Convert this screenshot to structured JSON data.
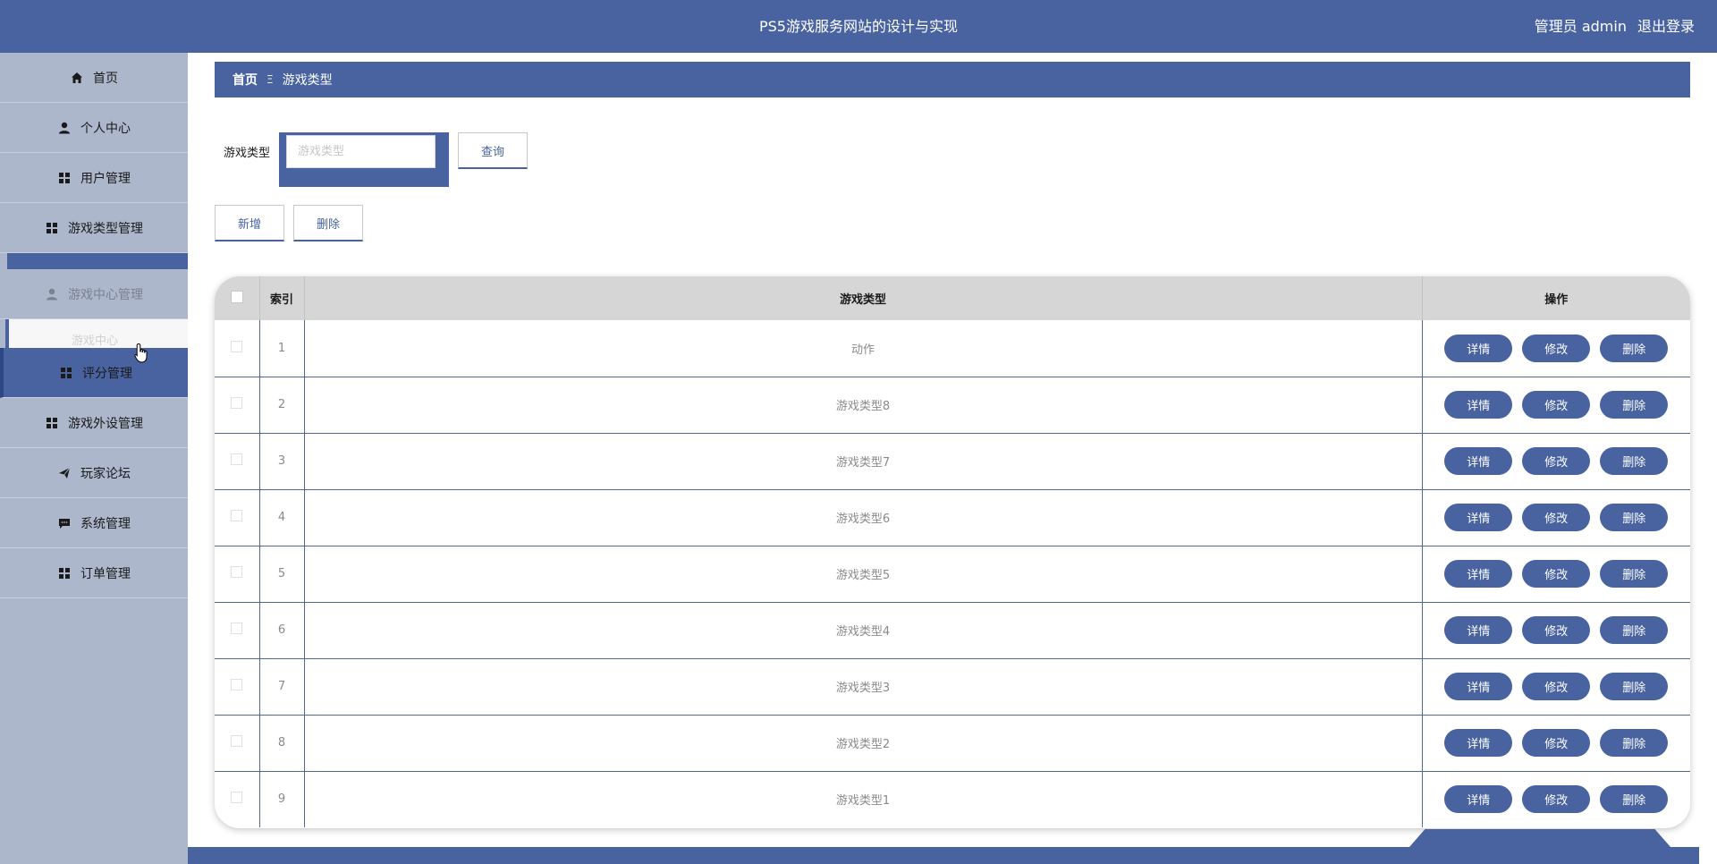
{
  "header": {
    "title": "PS5游戏服务网站的设计与实现",
    "user_label": "管理员 admin",
    "logout_label": "退出登录"
  },
  "sidebar": {
    "items": [
      {
        "label": "首页",
        "icon": "home-icon"
      },
      {
        "label": "个人中心",
        "icon": "person-icon"
      },
      {
        "label": "用户管理",
        "icon": "grid-icon"
      },
      {
        "label": "游戏类型管理",
        "icon": "grid-icon"
      },
      {
        "label": "游戏中心管理",
        "icon": "person-icon"
      },
      {
        "label": "评分管理",
        "icon": "grid-icon"
      },
      {
        "label": "游戏外设管理",
        "icon": "grid-icon"
      },
      {
        "label": "玩家论坛",
        "icon": "send-icon"
      },
      {
        "label": "系统管理",
        "icon": "chat-icon"
      },
      {
        "label": "订单管理",
        "icon": "grid-icon"
      }
    ],
    "submenu_item": "游戏中心"
  },
  "breadcrumb": {
    "home": "首页",
    "separator": "Ξ",
    "current": "游戏类型"
  },
  "search": {
    "label": "游戏类型",
    "placeholder": "游戏类型",
    "button": "查询"
  },
  "actions": {
    "add": "新增",
    "delete": "删除"
  },
  "table": {
    "columns": [
      "索引",
      "游戏类型",
      "操作"
    ],
    "rows": [
      {
        "index": "1",
        "type": "动作"
      },
      {
        "index": "2",
        "type": "游戏类型8"
      },
      {
        "index": "3",
        "type": "游戏类型7"
      },
      {
        "index": "4",
        "type": "游戏类型6"
      },
      {
        "index": "5",
        "type": "游戏类型5"
      },
      {
        "index": "6",
        "type": "游戏类型4"
      },
      {
        "index": "7",
        "type": "游戏类型3"
      },
      {
        "index": "8",
        "type": "游戏类型2"
      },
      {
        "index": "9",
        "type": "游戏类型1"
      }
    ],
    "row_actions": {
      "detail": "详情",
      "edit": "修改",
      "delete": "删除"
    }
  },
  "colors": {
    "primary": "#4863a0",
    "sidebar_bg": "#adb7cc",
    "header_row": "#d6d6d6"
  }
}
